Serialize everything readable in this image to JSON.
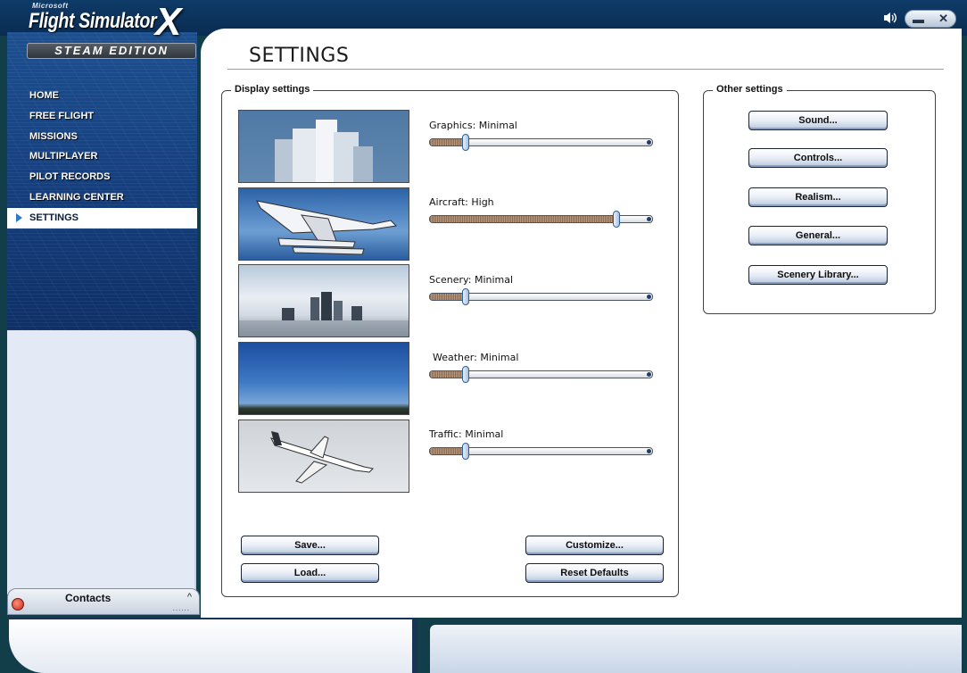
{
  "app": {
    "logo_ms": "Microsoft",
    "logo_title": "Flight Simulator",
    "logo_x": "X",
    "logo_edition": "STEAM EDITION"
  },
  "window": {
    "speaker_icon": "speaker-icon",
    "minimize_glyph": "▬",
    "close_glyph": "✕"
  },
  "nav": {
    "items": [
      "HOME",
      "FREE FLIGHT",
      "MISSIONS",
      "MULTIPLAYER",
      "PILOT RECORDS",
      "LEARNING CENTER",
      "SETTINGS"
    ],
    "active": "SETTINGS"
  },
  "page": {
    "title": "SETTINGS"
  },
  "display": {
    "label": "Display settings",
    "sliders": [
      {
        "label": "Graphics: Minimal",
        "level": 0.16
      },
      {
        "label": "Aircraft: High",
        "level": 0.84
      },
      {
        "label": "Scenery: Minimal",
        "level": 0.16
      },
      {
        "label": "Weather: Minimal",
        "level": 0.16
      },
      {
        "label": "Traffic: Minimal",
        "level": 0.16
      }
    ],
    "thumbnails": [
      "graphics-preview",
      "aircraft-preview",
      "scenery-preview",
      "weather-preview",
      "traffic-preview"
    ]
  },
  "other": {
    "label": "Other settings",
    "buttons": [
      "Sound...",
      "Controls...",
      "Realism...",
      "General...",
      "Scenery Library..."
    ]
  },
  "actions": {
    "save": "Save...",
    "load": "Load...",
    "customize": "Customize...",
    "reset": "Reset Defaults"
  },
  "contacts": {
    "label": "Contacts",
    "chevron": "^",
    "grip": "......"
  }
}
